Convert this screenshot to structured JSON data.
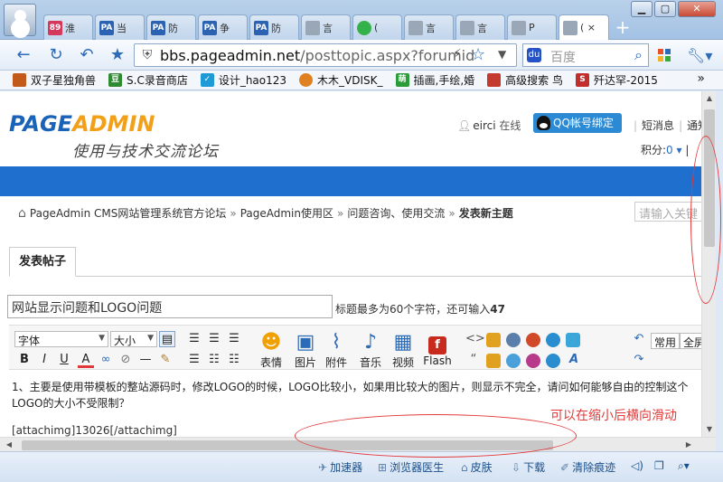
{
  "browser": {
    "tabs": [
      {
        "label": "淮",
        "icon": "89",
        "color": "#d4385a"
      },
      {
        "label": "当",
        "icon": "PA",
        "color": "#2b63b2"
      },
      {
        "label": "防",
        "icon": "PA",
        "color": "#2b63b2"
      },
      {
        "label": "争",
        "icon": "PA",
        "color": "#2b63b2"
      },
      {
        "label": "防",
        "icon": "PA",
        "color": "#2b63b2"
      },
      {
        "label": "言",
        "icon": "",
        "color": "#9aa7b6"
      },
      {
        "label": "(",
        "icon": "",
        "color": "#33b24a"
      },
      {
        "label": "言",
        "icon": "",
        "color": "#9aa7b6"
      },
      {
        "label": "言",
        "icon": "",
        "color": "#9aa7b6"
      },
      {
        "label": "P",
        "icon": "",
        "color": "#9aa7b6"
      },
      {
        "label": "( ×",
        "icon": "",
        "color": "#9aa7b6"
      }
    ],
    "url_host": "bbs.pageadmin.net",
    "url_path": "/posttopic.aspx?forumid",
    "search_placeholder": "百度",
    "bookmarks": [
      {
        "label": "双子星独角兽",
        "color": "#c25a1c",
        "icon": ""
      },
      {
        "label": "S.C录音商店",
        "color": "#2f8a32",
        "icon": "豆"
      },
      {
        "label": "设计_hao123",
        "color": "#1e9ad6",
        "icon": "✓"
      },
      {
        "label": "木木_VDISK_",
        "color": "#e0801f",
        "icon": ""
      },
      {
        "label": "插画,手绘,婚",
        "color": "#2c9c3a",
        "icon": "萌"
      },
      {
        "label": "高级搜索 鸟",
        "color": "#c43a2e",
        "icon": ""
      },
      {
        "label": "歼达罕-2015",
        "color": "#c22e2e",
        "icon": "S"
      }
    ]
  },
  "site": {
    "logo_part1": "PAGE",
    "logo_part2": "ADMIN",
    "logo_sub": "使用与技术交流论坛",
    "user_name": "eirci",
    "user_status": "在线",
    "qq_button": "QQ帐号绑定",
    "link_messages": "短消息",
    "link_notice": "通知",
    "score_label": "积分:",
    "score_value": "0",
    "breadcrumbs": [
      "PageAdmin CMS网站管理系统官方论坛",
      "PageAdmin使用区",
      "问题咨询、使用交流",
      "发表新主题"
    ],
    "search_placeholder": "请输入关键",
    "post_tab": "发表帖子",
    "post_title": "网站显示问题和LOGO问题",
    "title_hint_prefix": "标题最多为60个字符，还可输入",
    "title_hint_count": "47"
  },
  "editor": {
    "font_select": "字体",
    "size_select": "大小",
    "buttons": [
      {
        "label": "表情",
        "icon": "smile-icon"
      },
      {
        "label": "图片",
        "icon": "image-icon"
      },
      {
        "label": "附件",
        "icon": "paperclip-icon"
      },
      {
        "label": "音乐",
        "icon": "music-icon"
      },
      {
        "label": "视频",
        "icon": "video-icon"
      },
      {
        "label": "Flash",
        "icon": "flash-icon"
      }
    ],
    "common_btn": "常用",
    "full_btn": "全屏",
    "content_line1": "1、主要是使用带模板的整站源码时，修改LOGO的时候，LOGO比较小，如果用比较大的图片，则显示不完全，请问如何能够自由的控制这个LOGO的大小不受限制？",
    "content_attach": "[attachimg]13026[/attachimg]"
  },
  "status": {
    "items": [
      "加速器",
      "浏览器医生",
      "皮肤",
      "下载",
      "清除痕迹"
    ]
  },
  "annotation_text": "可以在缩小后横向滑动"
}
